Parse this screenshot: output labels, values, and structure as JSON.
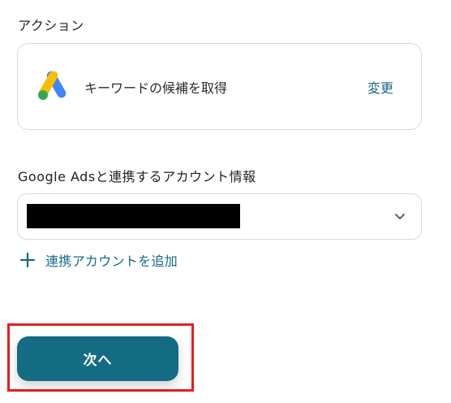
{
  "action_section": {
    "label": "アクション",
    "action_name": "キーワードの候補を取得",
    "change_label": "変更",
    "logo": "google-ads-logo"
  },
  "account_section": {
    "label": "Google Adsと連携するアカウント情報",
    "selected_value": "",
    "add_account_label": "連携アカウントを追加"
  },
  "footer": {
    "next_label": "次へ"
  },
  "colors": {
    "accent": "#146a86",
    "button_bg": "#136b84",
    "highlight_border": "#e02121",
    "card_border": "#d6dadf"
  }
}
